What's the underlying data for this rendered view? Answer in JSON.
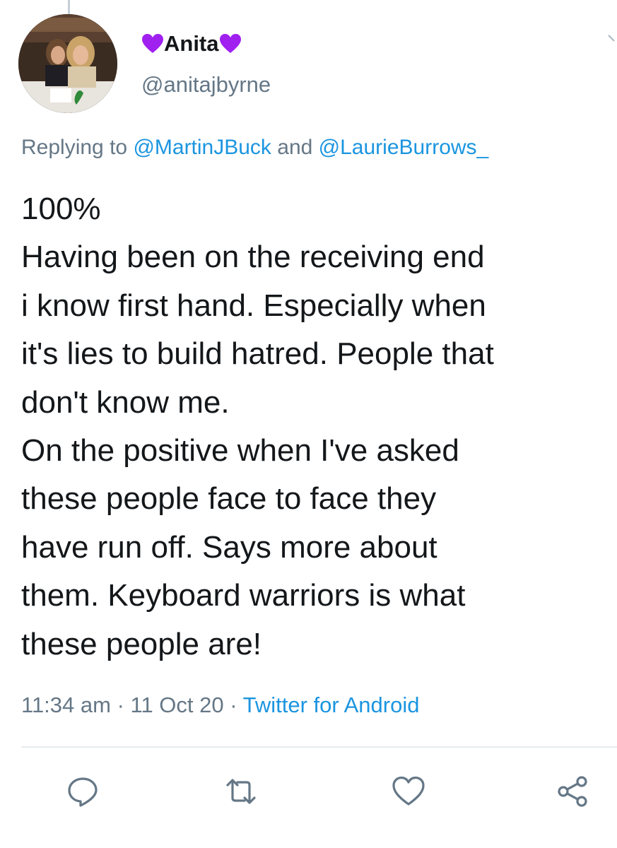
{
  "author": {
    "display_name_prefix_icon": "purple-heart-icon",
    "display_name": "Anita",
    "display_name_suffix_icon": "purple-heart-icon",
    "handle": "@anitajbyrne",
    "avatar": "profile-photo"
  },
  "reply": {
    "prefix": "Replying to ",
    "mention_1": "@MartinJBuck",
    "joiner": " and ",
    "mention_2": "@LaurieBurrows_"
  },
  "tweet": {
    "lines": [
      "100%",
      "Having been on the receiving end",
      "i know first hand. Especially when",
      "it's lies to build hatred. People that",
      "don't know me.",
      "On the positive when I've asked",
      "these people face to face they",
      "have run off. Says more about",
      "them. Keyboard warriors is what",
      "these people are!"
    ]
  },
  "meta": {
    "time": "11:34 am",
    "sep1": " · ",
    "date": "11 Oct 20",
    "sep2": " · ",
    "source": "Twitter for Android"
  },
  "actions": {
    "reply_icon": "reply-icon",
    "retweet_icon": "retweet-icon",
    "like_icon": "heart-icon",
    "share_icon": "share-icon"
  },
  "colors": {
    "link": "#1b95e0",
    "secondary_text": "#657786",
    "primary_text": "#14171a",
    "heart_emoji": "#a020f0"
  }
}
